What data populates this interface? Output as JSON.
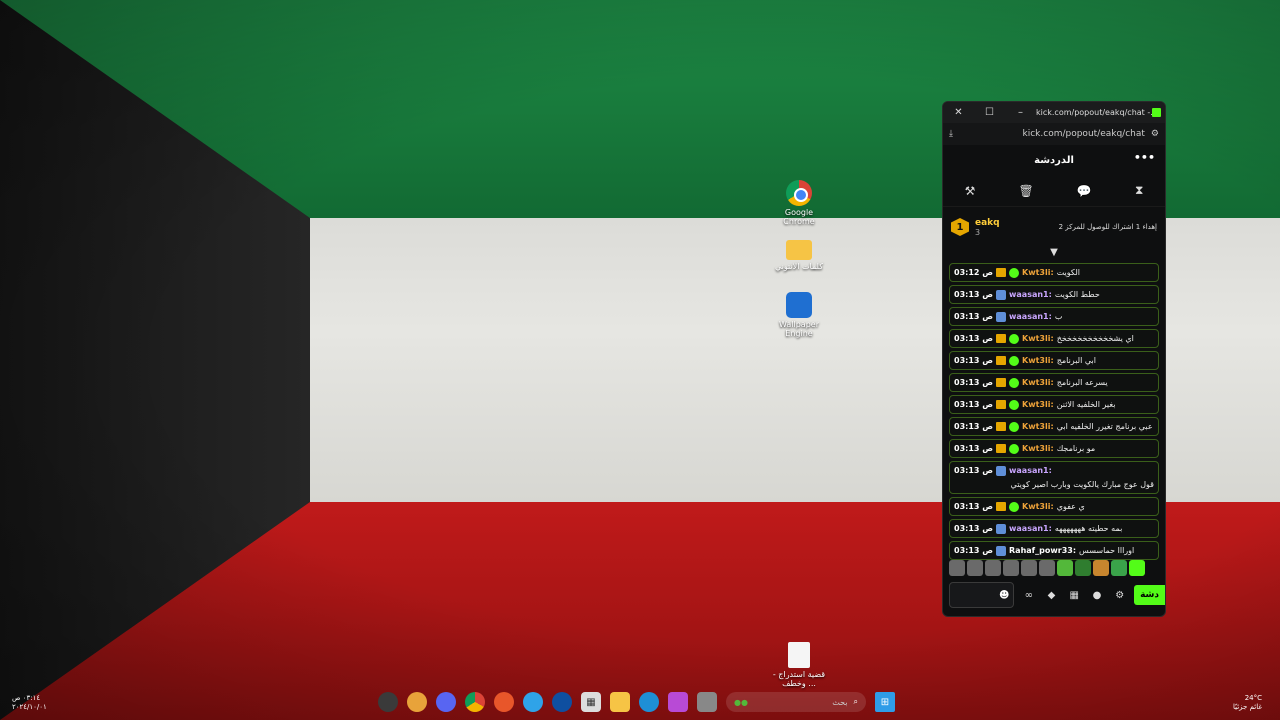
{
  "desktop": {
    "icons": [
      {
        "label": "Google Chrome",
        "icon": "chrome-icon"
      },
      {
        "label": "كلمات الانتوني",
        "icon": "folder-icon"
      },
      {
        "label": "Wallpaper Engine",
        "icon": "wallpaper-engine-icon"
      },
      {
        "label": "قضية استدراج - وخطف ...",
        "icon": "document-icon"
      }
    ]
  },
  "popup": {
    "title": "kick.com/popout/eakq/chat -...",
    "url": "kick.com/popout/eakq/chat",
    "chat_header": "الدردشة",
    "pinned": {
      "rank": "1",
      "username": "eakq",
      "sub_count": "3",
      "goal_text": "إهداء 1 اشتراك للوصول للمركز 2"
    },
    "messages": [
      {
        "time": "03:12 ص",
        "user": "Kwt3li:",
        "color": "#f0a43a",
        "type": "ver",
        "text": "الكويت"
      },
      {
        "time": "03:13 ص",
        "user": "waasan1:",
        "color": "#c9a6ff",
        "type": "og",
        "text": "حطط الكويت"
      },
      {
        "time": "03:13 ص",
        "user": "waasan1:",
        "color": "#c9a6ff",
        "type": "og",
        "text": "ب"
      },
      {
        "time": "03:13 ص",
        "user": "Kwt3li:",
        "color": "#f0a43a",
        "type": "ver",
        "text": "اي يشخخخخخخخخخخخ"
      },
      {
        "time": "03:13 ص",
        "user": "Kwt3li:",
        "color": "#f0a43a",
        "type": "ver",
        "text": "ابي البرنامج"
      },
      {
        "time": "03:13 ص",
        "user": "Kwt3li:",
        "color": "#f0a43a",
        "type": "ver",
        "text": "يسرعه البرنامج"
      },
      {
        "time": "03:13 ص",
        "user": "Kwt3li:",
        "color": "#f0a43a",
        "type": "ver",
        "text": "بغير الخلفيه الاثنن"
      },
      {
        "time": "03:13 ص",
        "user": "Kwt3li:",
        "color": "#f0a43a",
        "type": "ver",
        "text": "لا ي عبي برنامج تغيرر الخلفيه ابي"
      },
      {
        "time": "03:13 ص",
        "user": "Kwt3li:",
        "color": "#f0a43a",
        "type": "ver",
        "text": "مو برنامجك"
      },
      {
        "time": "03:13 ص",
        "user": "waasan1:",
        "color": "#c9a6ff",
        "type": "og",
        "text": "قول عوج مبارك يالكويت وبارب اصير كويتي",
        "tall": true
      },
      {
        "time": "03:13 ص",
        "user": "Kwt3li:",
        "color": "#f0a43a",
        "type": "ver",
        "text": "ي عفوي"
      },
      {
        "time": "03:13 ص",
        "user": "waasan1:",
        "color": "#c9a6ff",
        "type": "og",
        "text": "بمه حطيته هههههههه"
      },
      {
        "time": "03:13 ص",
        "user": "Rahaf_powr33:",
        "color": "#ffffff",
        "type": "og",
        "text": "اورااا حماسسس"
      }
    ],
    "send_label": "دشة"
  },
  "taskbar": {
    "search_placeholder": "بحث",
    "temperature": "24°C",
    "weather": "غائم جزئيًا",
    "time": "٠٣:١٤ ص",
    "date": "٢٠٢٤/١٠/٠١"
  }
}
